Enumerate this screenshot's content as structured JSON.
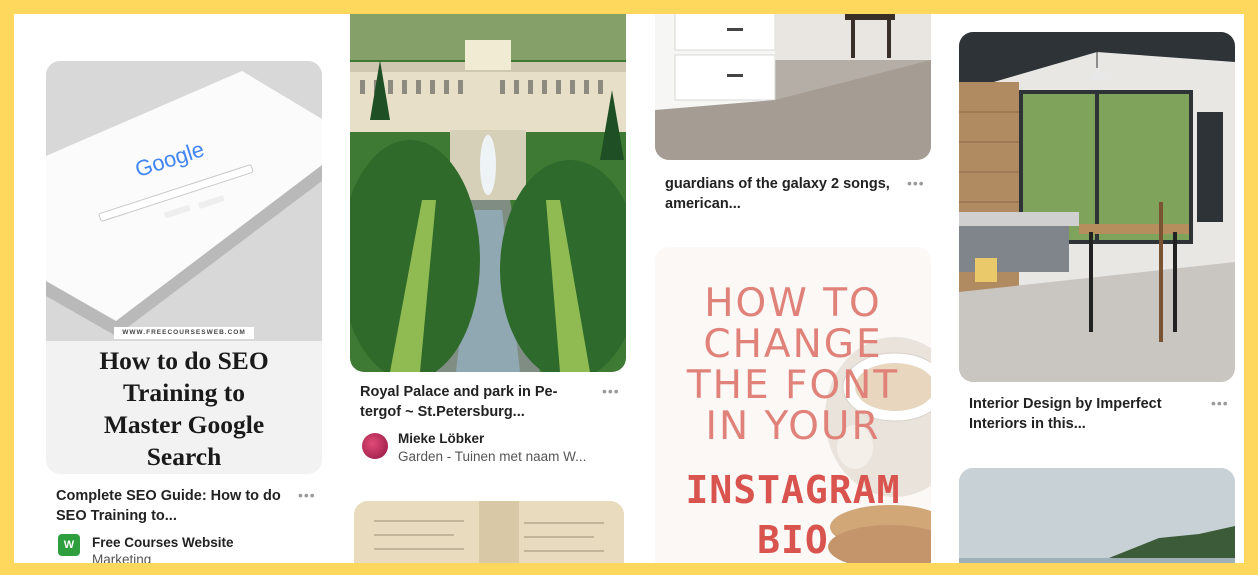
{
  "pins": [
    {
      "title": "Complete SEO Guide: How to do SEO Training to...",
      "more_label": "•••",
      "author": "Free Courses Website",
      "board": "Marketing",
      "image": {
        "site_label": "WWW.FREECOURSESWEB.COM",
        "heading_lines": [
          "How to do SEO",
          "Training to",
          "Master Google",
          "Search"
        ],
        "logo_text": "Google"
      },
      "avatar_letter": "W"
    },
    {
      "title": "Royal Palace and park in Pe-tergof ~ St.Petersburg...",
      "more_label": "•••",
      "author": "Mieke Löbker",
      "board": "Garden - Tuinen met naam W..."
    },
    {
      "title": "guardians of the galaxy 2 songs, american...",
      "more_label": "•••"
    },
    {
      "image": {
        "line1": "HOW TO",
        "line2": "CHANGE",
        "line3": "THE FONT",
        "line4": "IN YOUR",
        "line5": "INSTAGRAM",
        "line6": "BIO"
      }
    },
    {
      "title": "Interior Design by Imperfect Interiors in this...",
      "more_label": "•••"
    }
  ],
  "colors": {
    "frame_border": "#fdd85d",
    "seo_bg": "#f2f2f2",
    "font_pin_text": "#e0827a",
    "instagram_text": "#d9534f"
  }
}
